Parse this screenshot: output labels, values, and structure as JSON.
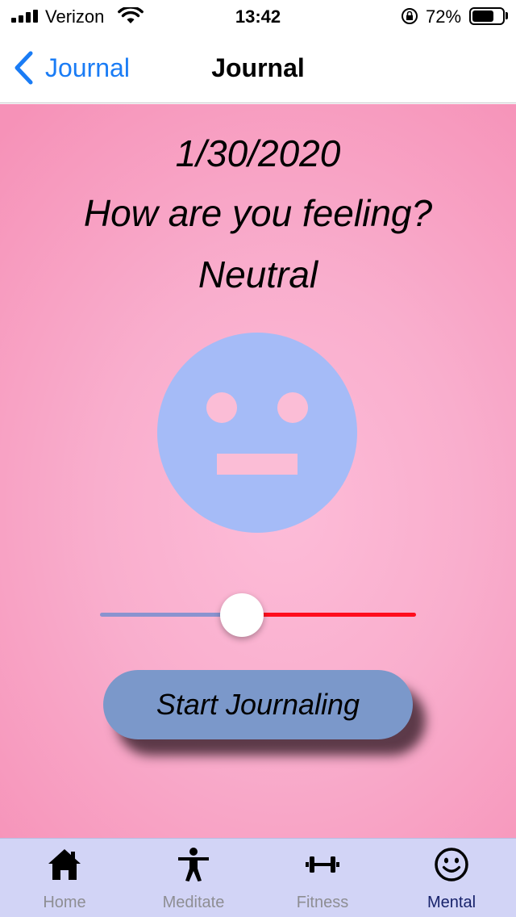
{
  "status_bar": {
    "carrier": "Verizon",
    "time": "13:42",
    "battery_percent": "72%",
    "battery_level": 0.72
  },
  "nav": {
    "back_label": "Journal",
    "title": "Journal"
  },
  "main": {
    "date": "1/30/2020",
    "question": "How are you feeling?",
    "mood": "Neutral",
    "slider_value": 0.5,
    "start_label": "Start Journaling"
  },
  "colors": {
    "face": "#a5bbf7",
    "track_min": "#8a93cf",
    "track_max": "#ff0d1e",
    "button": "#7b98ca",
    "accent_blue": "#1a7cf5",
    "tab_active": "#17226b",
    "tab_inactive": "#8e8e93"
  },
  "tabs": [
    {
      "label": "Home",
      "icon": "house-icon",
      "active": false
    },
    {
      "label": "Meditate",
      "icon": "person-icon",
      "active": false
    },
    {
      "label": "Fitness",
      "icon": "dumbbell-icon",
      "active": false
    },
    {
      "label": "Mental",
      "icon": "smiley-icon",
      "active": true
    }
  ]
}
